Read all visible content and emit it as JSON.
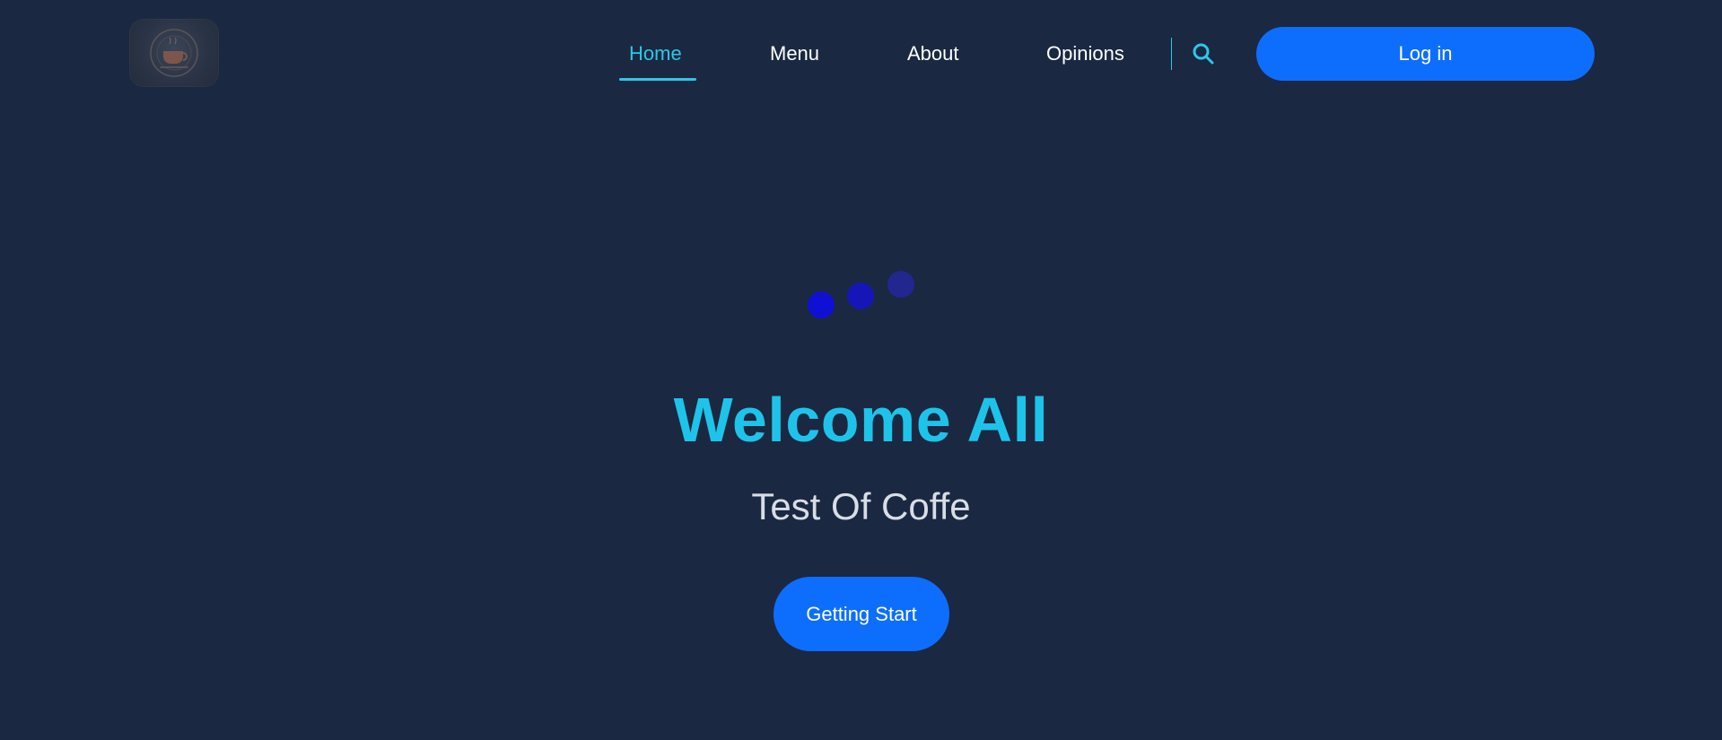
{
  "nav": {
    "logo_icon": "coffee-shop-logo",
    "items": [
      {
        "label": "Home",
        "active": true
      },
      {
        "label": "Menu",
        "active": false
      },
      {
        "label": "About",
        "active": false
      },
      {
        "label": "Opinions",
        "active": false
      }
    ],
    "search_icon": "search-icon",
    "login_label": "Log in"
  },
  "hero": {
    "title": "Welcome All",
    "subtitle": "Test Of Coffe",
    "cta_label": "Getting Start"
  },
  "colors": {
    "background": "#1a2842",
    "accent_cyan": "#1ec3ea",
    "button_blue": "#0d6efd",
    "loader_dot": "#0f0fd6"
  }
}
